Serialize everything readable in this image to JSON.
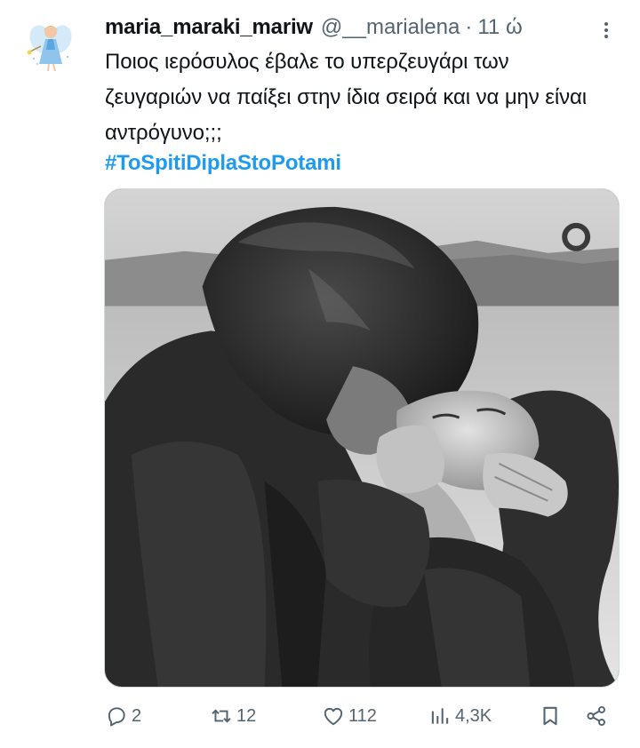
{
  "tweet": {
    "display_name": "maria_maraki_mariw",
    "handle": "@__marialena",
    "separator": "·",
    "time": "11 ώ",
    "text": "Ποιος ιερόσυλος έβαλε το υπερζευγάρι των ζευγαριών να παίξει στην ίδια σειρά και να μην είναι αντρόγυνο;;;",
    "hashtag": "#ToSpitiDiplaStoPotami"
  },
  "actions": {
    "replies": "2",
    "retweets": "12",
    "likes": "112",
    "views": "4,3K"
  },
  "icons": {
    "avatar": "fairy-avatar",
    "more": "more-vertical-icon",
    "reply": "reply-icon",
    "retweet": "retweet-icon",
    "like": "heart-icon",
    "views": "views-icon",
    "bookmark": "bookmark-icon",
    "share": "share-icon"
  },
  "colors": {
    "text": "#0f1419",
    "muted": "#536471",
    "link": "#1d9bf0",
    "border": "#cfd9de"
  }
}
